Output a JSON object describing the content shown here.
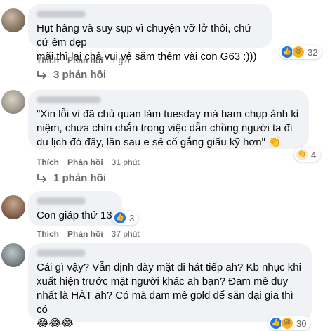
{
  "comments": [
    {
      "text": "Hụt hâng và suy sụp vì chuyện vỡ lở thôi, chứ cứ êm đẹp\nmãi thì lại chả vui vẻ sắm thêm vài con G63 :)))",
      "like_label": "Thích",
      "reply_label": "Phản hồi",
      "time": "1 giờ",
      "reactions": [
        "like-icon",
        "haha-icon"
      ],
      "reaction_count": "32",
      "replies_label": "3 phản hồi"
    },
    {
      "text": "\"Xin lỗi vì đã chủ quan làm tuesday mà ham chụp ảnh kỉ\nniệm, chưa chín chắn trong việc dẫn chồng người ta đi\ndu lịch đó đây, lần sau e sẽ cố gắng giấu kỹ hơn\" 👏",
      "like_label": "Thích",
      "reply_label": "Phản hồi",
      "time": "31 phút",
      "reactions": [
        "clap-icon"
      ],
      "reaction_count": "4",
      "replies_label": "1 phản hồi"
    },
    {
      "text": "Con giáp thứ 13",
      "like_label": "Thích",
      "reply_label": "Phản hồi",
      "time": "37 phút",
      "reactions": [
        "like-icon"
      ],
      "reaction_count": "3"
    },
    {
      "text": "Cái gì vậy? Vẫn định dày mặt đi hát tiếp ah? Kb nhục khi\nxuất hiện trước mặt người khác ah bạn? Đam mê duy\nnhất là HÁT ah? Có mà đam mê gold để săn đại gia thì có\n😂😂😂",
      "reactions": [
        "like-icon",
        "haha-icon"
      ],
      "reaction_count": "30"
    }
  ]
}
